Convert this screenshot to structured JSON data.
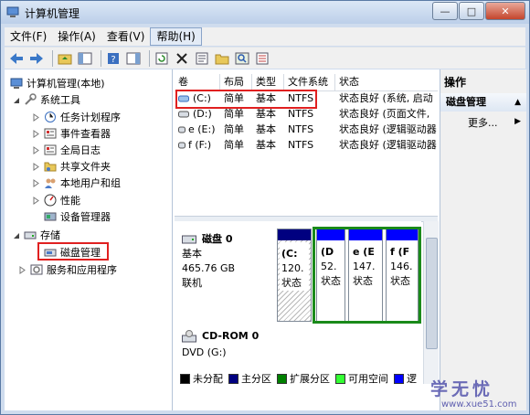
{
  "window": {
    "title": "计算机管理"
  },
  "menu": {
    "items": [
      "文件(F)",
      "操作(A)",
      "查看(V)",
      "帮助(H)"
    ]
  },
  "tree": {
    "root": "计算机管理(本地)",
    "system_tools": "系统工具",
    "items": [
      "任务计划程序",
      "事件查看器",
      "全局日志",
      "共享文件夹",
      "本地用户和组",
      "性能",
      "设备管理器"
    ],
    "storage": "存储",
    "disk_mgmt": "磁盘管理",
    "services": "服务和应用程序"
  },
  "volume_list": {
    "columns": [
      "卷",
      "布局",
      "类型",
      "文件系统",
      "状态"
    ],
    "rows": [
      {
        "vol": "(C:)",
        "layout": "简单",
        "type": "基本",
        "fs": "NTFS",
        "status": "状态良好 (系统, 启动"
      },
      {
        "vol": "(D:)",
        "layout": "简单",
        "type": "基本",
        "fs": "NTFS",
        "status": "状态良好 (页面文件,"
      },
      {
        "vol": "e (E:)",
        "layout": "简单",
        "type": "基本",
        "fs": "NTFS",
        "status": "状态良好 (逻辑驱动器"
      },
      {
        "vol": "f (F:)",
        "layout": "简单",
        "type": "基本",
        "fs": "NTFS",
        "status": "状态良好 (逻辑驱动器"
      }
    ]
  },
  "disks": {
    "disk0": {
      "name": "磁盘 0",
      "type": "基本",
      "size": "465.76 GB",
      "status": "联机"
    },
    "cdrom0": {
      "name": "CD-ROM 0",
      "type": "DVD (G:)"
    },
    "partitions": [
      {
        "l1": "(C:",
        "l2": "120.",
        "l3": "状态"
      },
      {
        "l1": "(D",
        "l2": "52.",
        "l3": "状态"
      },
      {
        "l1": "e (E",
        "l2": "147.",
        "l3": "状态"
      },
      {
        "l1": "f (F",
        "l2": "146.",
        "l3": "状态"
      }
    ]
  },
  "legend": [
    "未分配",
    "主分区",
    "扩展分区",
    "可用空间",
    "逻"
  ],
  "legend_colors": [
    "#000000",
    "#000080",
    "#008000",
    "#33ff33",
    "#0000ff"
  ],
  "actions": {
    "header": "操作",
    "sub": "磁盘管理",
    "more": "更多..."
  },
  "watermark": {
    "brand": "学无忧",
    "url": "www.xue51.com"
  },
  "colors": {
    "highlight_red": "#e02020",
    "highlight_green": "#1a8a1a",
    "primary_partition": "#0000c8"
  }
}
